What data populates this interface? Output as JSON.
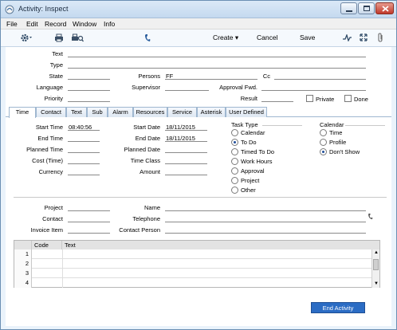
{
  "window": {
    "title": "Activity: Inspect"
  },
  "menu": [
    "File",
    "Edit",
    "Record",
    "Window",
    "Info"
  ],
  "toolbar": {
    "create_label": "Create",
    "cancel_label": "Cancel",
    "save_label": "Save"
  },
  "header": {
    "text_label": "Text",
    "type_label": "Type",
    "state_label": "State",
    "language_label": "Language",
    "priority_label": "Priority",
    "persons_label": "Persons",
    "persons_value": "FF",
    "cc_label": "Cc",
    "supervisor_label": "Supervisor",
    "approval_label": "Approval Fwd.",
    "result_label": "Result",
    "private_label": "Private",
    "done_label": "Done"
  },
  "tabs": [
    "Time",
    "Contact",
    "Text",
    "Sub",
    "Alarm",
    "Resources",
    "Service",
    "Asterisk",
    "User Defined"
  ],
  "time": {
    "start_time_label": "Start Time",
    "start_time_value": "08:40:56",
    "end_time_label": "End Time",
    "planned_time_label": "Planned Time",
    "cost_time_label": "Cost (Time)",
    "currency_label": "Currency",
    "start_date_label": "Start Date",
    "start_date_value": "18/11/2015",
    "end_date_label": "End Date",
    "end_date_value": "18/11/2015",
    "planned_date_label": "Planned Date",
    "time_class_label": "Time Class",
    "amount_label": "Amount"
  },
  "task_type": {
    "title": "Task Type",
    "options": [
      "Calendar",
      "To Do",
      "Timed To Do",
      "Work Hours",
      "Approval",
      "Project",
      "Other"
    ]
  },
  "calendar": {
    "title": "Calendar",
    "options": [
      "Time",
      "Profile",
      "Don't Show"
    ]
  },
  "footer": {
    "project_label": "Project",
    "contact_label": "Contact",
    "invoice_label": "Invoice Item",
    "name_label": "Name",
    "telephone_label": "Telephone",
    "contact_person_label": "Contact Person"
  },
  "grid": {
    "headers": [
      "Code",
      "Text"
    ],
    "rows": [
      "1",
      "2",
      "3",
      "4"
    ]
  },
  "end_activity_label": "End Activity",
  "colors": {
    "accent": "#2b6cc4",
    "tab_border": "#9fb7d0"
  }
}
